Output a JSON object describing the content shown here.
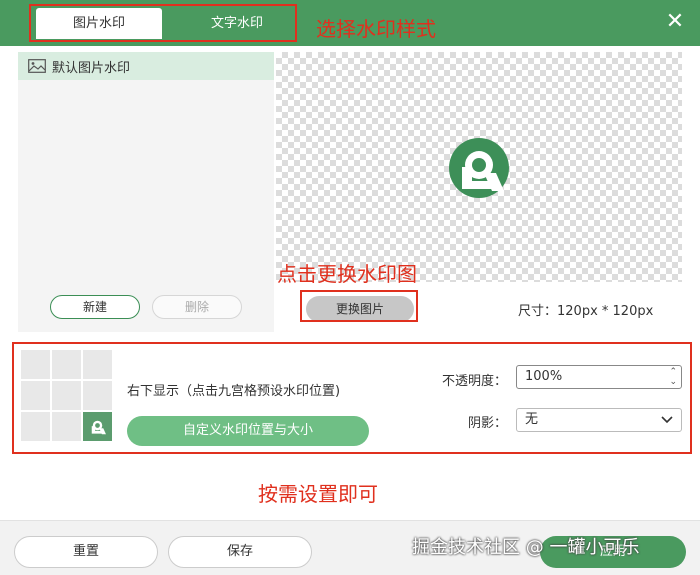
{
  "header": {
    "tabs": [
      {
        "label": "图片水印",
        "active": true
      },
      {
        "label": "文字水印",
        "active": false
      }
    ],
    "close_icon": "close-icon"
  },
  "annotations": {
    "select_style": "选择水印样式",
    "change_image": "点击更换水印图",
    "set_as_needed": "按需设置即可"
  },
  "watermark_list": {
    "items": [
      {
        "label": "默认图片水印",
        "icon": "image-icon"
      }
    ],
    "new_label": "新建",
    "delete_label": "删除"
  },
  "preview": {
    "change_label": "更换图片",
    "size_label": "尺寸：120px * 120px"
  },
  "position": {
    "text": "右下显示（点击九宫格预设水印位置)",
    "selected_cell": 8,
    "custom_label": "自定义水印位置与大小"
  },
  "opacity": {
    "label": "不透明度：",
    "value": "100%"
  },
  "shadow": {
    "label": "阴影：",
    "value": "无"
  },
  "footer": {
    "reset_label": "重置",
    "save_label": "保存",
    "apply_label": "应用",
    "credit": "掘金技术社区 @ 一罐小可乐"
  },
  "colors": {
    "brand": "#4a9a5f",
    "annotation": "#e0301e"
  }
}
